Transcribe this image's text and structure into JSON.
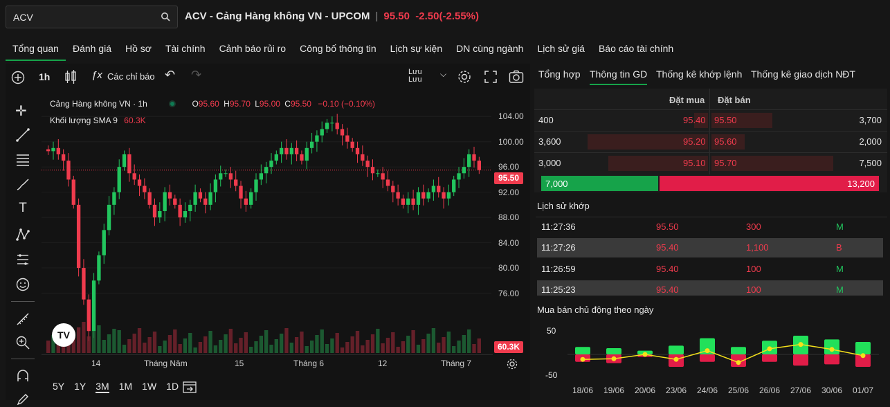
{
  "search": {
    "value": "ACV",
    "placeholder": ""
  },
  "header": {
    "title": "ACV - Cảng Hàng không VN - UPCOM",
    "price": "95.50",
    "change": "-2.50(-2.55%)"
  },
  "nav": [
    "Tổng quan",
    "Đánh giá",
    "Hồ sơ",
    "Tài chính",
    "Cảnh báo rủi ro",
    "Công bố thông tin",
    "Lịch sự kiện",
    "DN cùng ngành",
    "Lịch sử giá",
    "Báo cáo tài chính"
  ],
  "toolbar": {
    "interval": "1h",
    "indicators": "Các chỉ báo",
    "save_top": "Lưu",
    "save_bottom": "Lưu"
  },
  "legend": {
    "symbol_name": "Cảng Hàng không VN · 1h",
    "o_label": "O",
    "o": "95.60",
    "h_label": "H",
    "h": "95.70",
    "l_label": "L",
    "l": "95.00",
    "c_label": "C",
    "c": "95.50",
    "chg": "−0.10 (−0.10%)",
    "vol_label": "Khối lượng SMA 9",
    "vol": "60.3K"
  },
  "ranges": [
    "5Y",
    "1Y",
    "3M",
    "1M",
    "1W",
    "1D"
  ],
  "colors": {
    "up": "#22c55e",
    "down": "#ef3b4d",
    "accent": "#16a34a"
  },
  "chart_data": {
    "type": "candlestick",
    "y_ticks": [
      "104.00",
      "100.00",
      "96.00",
      "92.00",
      "88.00",
      "84.00",
      "80.00",
      "76.00"
    ],
    "ylim": [
      72,
      106
    ],
    "x_ticks": [
      "14",
      "Tháng Năm",
      "15",
      "Tháng 6",
      "12",
      "Tháng 7"
    ],
    "last_price_label": "95.50",
    "last_volume_label": "60.3K",
    "close_series": [
      98.5,
      99,
      98,
      97,
      94,
      90,
      80,
      75,
      70,
      78,
      82,
      86,
      90,
      92,
      96,
      98,
      95,
      94,
      93,
      92,
      90,
      88,
      89,
      92,
      91,
      90,
      88,
      89,
      90,
      92,
      91,
      90,
      92,
      94,
      95,
      95,
      94,
      93,
      91,
      90,
      92,
      94,
      95,
      96,
      97,
      98,
      99,
      98,
      99,
      98,
      97,
      99,
      100,
      101,
      102,
      103,
      103,
      102,
      101,
      100,
      99,
      98,
      97,
      96,
      95,
      95,
      94,
      93,
      92,
      91,
      90,
      91,
      90,
      92,
      91,
      92,
      93,
      92,
      91,
      92,
      94,
      95,
      96,
      98,
      97,
      95.5
    ]
  },
  "right_tabs": [
    "Tổng hợp",
    "Thông tin GD",
    "Thống kê khớp lệnh",
    "Thống kê giao dịch NĐT"
  ],
  "order_book": {
    "bid_header": "Đặt mua",
    "ask_header": "Đặt bán",
    "rows": [
      {
        "bid_vol": "400",
        "bid": "95.40",
        "ask": "95.50",
        "ask_vol": "3,700"
      },
      {
        "bid_vol": "3,600",
        "bid": "95.20",
        "ask": "95.60",
        "ask_vol": "2,000"
      },
      {
        "bid_vol": "3,000",
        "bid": "95.10",
        "ask": "95.70",
        "ask_vol": "7,500"
      }
    ],
    "total_bid": "7,000",
    "total_ask": "13,200",
    "bid_share": 0.3466
  },
  "match_history": {
    "title": "Lịch sử khớp",
    "rows": [
      {
        "time": "11:27:36",
        "price": "95.50",
        "vol": "300",
        "side": "M"
      },
      {
        "time": "11:27:26",
        "price": "95.40",
        "vol": "1,100",
        "side": "B"
      },
      {
        "time": "11:26:59",
        "price": "95.40",
        "vol": "100",
        "side": "M"
      },
      {
        "time": "11:25:23",
        "price": "95.40",
        "vol": "100",
        "side": "M"
      }
    ]
  },
  "active_flow": {
    "title": "Mua bán chủ động theo ngày",
    "y_top": "50",
    "y_bottom": "-50",
    "dates": [
      "18/06",
      "19/06",
      "20/06",
      "23/06",
      "24/06",
      "25/06",
      "26/06",
      "27/06",
      "30/06",
      "01/07"
    ],
    "buy": [
      12,
      10,
      6,
      14,
      26,
      12,
      22,
      30,
      24,
      20
    ],
    "sell": [
      -12,
      -14,
      -4,
      -20,
      -12,
      -20,
      -12,
      -18,
      -16,
      -20
    ],
    "net": [
      -8,
      -7,
      0,
      -8,
      6,
      -13,
      9,
      16,
      8,
      -2
    ]
  }
}
